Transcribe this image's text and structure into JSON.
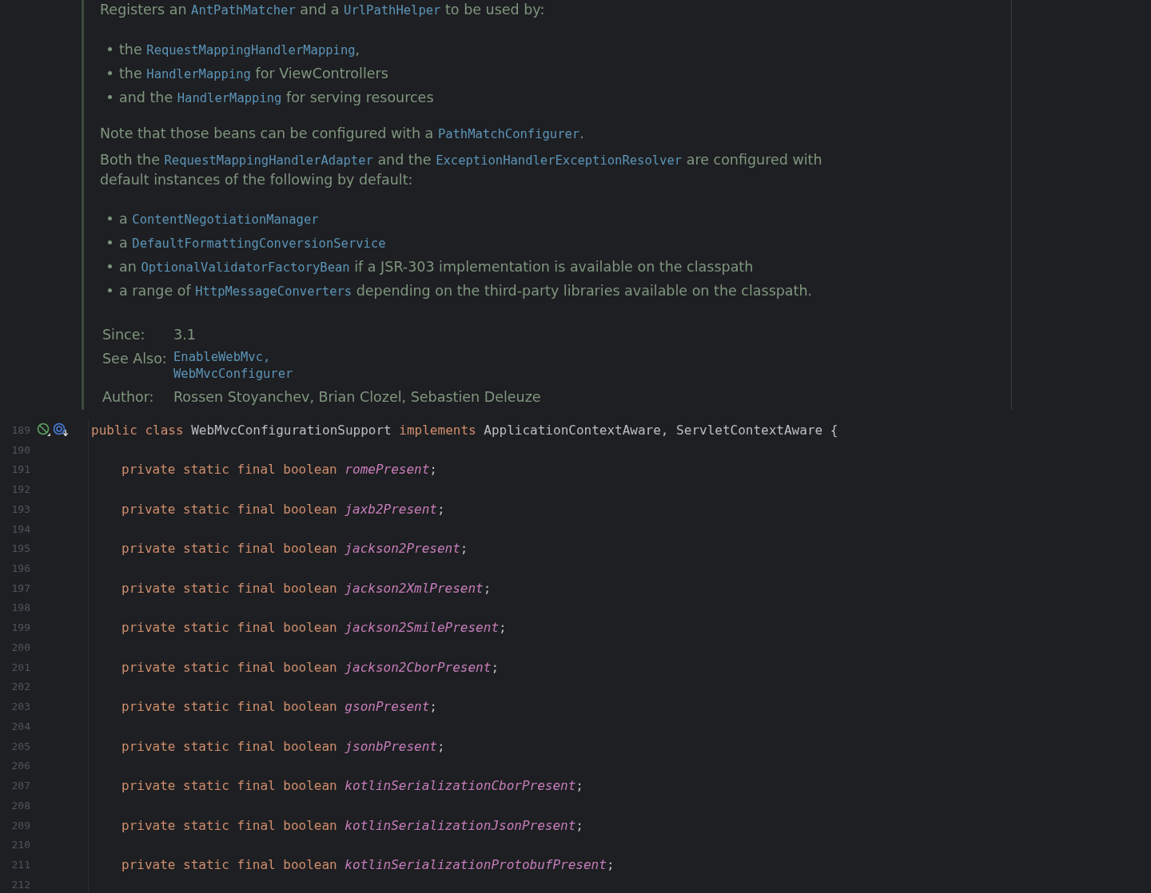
{
  "doc": {
    "paragraphs": [
      {
        "kind": "para",
        "parts": [
          {
            "kind": "text",
            "text": "Registers an "
          },
          {
            "kind": "code",
            "text": "AntPathMatcher"
          },
          {
            "kind": "text",
            "text": " and a "
          },
          {
            "kind": "code",
            "text": "UrlPathHelper"
          },
          {
            "kind": "text",
            "text": " to be used by:"
          }
        ]
      },
      {
        "kind": "bullet",
        "parts": [
          {
            "kind": "text",
            "text": "the "
          },
          {
            "kind": "code",
            "text": "RequestMappingHandlerMapping"
          },
          {
            "kind": "text",
            "text": ","
          }
        ]
      },
      {
        "kind": "bullet",
        "parts": [
          {
            "kind": "text",
            "text": "the "
          },
          {
            "kind": "code",
            "text": "HandlerMapping"
          },
          {
            "kind": "text",
            "text": " for ViewControllers"
          }
        ]
      },
      {
        "kind": "bullet",
        "parts": [
          {
            "kind": "text",
            "text": "and the "
          },
          {
            "kind": "code",
            "text": "HandlerMapping"
          },
          {
            "kind": "text",
            "text": " for serving resources"
          }
        ]
      },
      {
        "kind": "para",
        "parts": [
          {
            "kind": "text",
            "text": "Note that those beans can be configured with a "
          },
          {
            "kind": "code",
            "text": "PathMatchConfigurer"
          },
          {
            "kind": "text",
            "text": "."
          }
        ]
      },
      {
        "kind": "para",
        "parts": [
          {
            "kind": "text",
            "text": "Both the "
          },
          {
            "kind": "code",
            "text": "RequestMappingHandlerAdapter"
          },
          {
            "kind": "text",
            "text": " and the "
          },
          {
            "kind": "code",
            "text": "ExceptionHandlerExceptionResolver"
          },
          {
            "kind": "text",
            "text": " are configured with default instances of the following by default:"
          }
        ]
      },
      {
        "kind": "bullet",
        "parts": [
          {
            "kind": "text",
            "text": "a "
          },
          {
            "kind": "code",
            "text": "ContentNegotiationManager"
          }
        ]
      },
      {
        "kind": "bullet",
        "parts": [
          {
            "kind": "text",
            "text": "a "
          },
          {
            "kind": "code",
            "text": "DefaultFormattingConversionService"
          }
        ]
      },
      {
        "kind": "bullet",
        "parts": [
          {
            "kind": "text",
            "text": "an "
          },
          {
            "kind": "code",
            "text": "OptionalValidatorFactoryBean"
          },
          {
            "kind": "text",
            "text": " if a JSR-303 implementation is available on the classpath"
          }
        ]
      },
      {
        "kind": "bullet",
        "parts": [
          {
            "kind": "text",
            "text": "a range of "
          },
          {
            "kind": "code",
            "text": "HttpMessageConverters"
          },
          {
            "kind": "text",
            "text": " depending on the third-party libraries available on the classpath."
          }
        ]
      }
    ],
    "tags": [
      {
        "label": "Since:",
        "values": [
          "3.1"
        ],
        "kind": "text"
      },
      {
        "label": "See Also:",
        "values": [
          "EnableWebMvc,",
          "WebMvcConfigurer"
        ],
        "kind": "code"
      },
      {
        "label": "Author:",
        "values": [
          "Rossen Stoyanchev, Brian Clozel, Sebastien Deleuze"
        ],
        "kind": "text"
      }
    ]
  },
  "code_lines": [
    {
      "number": "189",
      "kind": "declaration",
      "tokens": [
        {
          "kind": "keyword",
          "text": "public class "
        },
        {
          "kind": "plain",
          "text": "WebMvcConfigurationSupport "
        },
        {
          "kind": "keyword",
          "text": "implements "
        },
        {
          "kind": "plain",
          "text": "ApplicationContextAware, ServletContextAware {"
        }
      ]
    },
    {
      "number": "190",
      "kind": "blank"
    },
    {
      "number": "191",
      "kind": "member",
      "tokens": [
        {
          "kind": "keyword",
          "text": "private static final boolean "
        },
        {
          "kind": "field",
          "text": "romePresent"
        },
        {
          "kind": "plain",
          "text": ";"
        }
      ]
    },
    {
      "number": "192",
      "kind": "blank"
    },
    {
      "number": "193",
      "kind": "member",
      "tokens": [
        {
          "kind": "keyword",
          "text": "private static final boolean "
        },
        {
          "kind": "field",
          "text": "jaxb2Present"
        },
        {
          "kind": "plain",
          "text": ";"
        }
      ]
    },
    {
      "number": "194",
      "kind": "blank"
    },
    {
      "number": "195",
      "kind": "member",
      "tokens": [
        {
          "kind": "keyword",
          "text": "private static final boolean "
        },
        {
          "kind": "field",
          "text": "jackson2Present"
        },
        {
          "kind": "plain",
          "text": ";"
        }
      ]
    },
    {
      "number": "196",
      "kind": "blank"
    },
    {
      "number": "197",
      "kind": "member",
      "tokens": [
        {
          "kind": "keyword",
          "text": "private static final boolean "
        },
        {
          "kind": "field",
          "text": "jackson2XmlPresent"
        },
        {
          "kind": "plain",
          "text": ";"
        }
      ]
    },
    {
      "number": "198",
      "kind": "blank"
    },
    {
      "number": "199",
      "kind": "member",
      "tokens": [
        {
          "kind": "keyword",
          "text": "private static final boolean "
        },
        {
          "kind": "field",
          "text": "jackson2SmilePresent"
        },
        {
          "kind": "plain",
          "text": ";"
        }
      ]
    },
    {
      "number": "200",
      "kind": "blank"
    },
    {
      "number": "201",
      "kind": "member",
      "tokens": [
        {
          "kind": "keyword",
          "text": "private static final boolean "
        },
        {
          "kind": "field",
          "text": "jackson2CborPresent"
        },
        {
          "kind": "plain",
          "text": ";"
        }
      ]
    },
    {
      "number": "202",
      "kind": "blank"
    },
    {
      "number": "203",
      "kind": "member",
      "tokens": [
        {
          "kind": "keyword",
          "text": "private static final boolean "
        },
        {
          "kind": "field",
          "text": "gsonPresent"
        },
        {
          "kind": "plain",
          "text": ";"
        }
      ]
    },
    {
      "number": "204",
      "kind": "blank"
    },
    {
      "number": "205",
      "kind": "member",
      "tokens": [
        {
          "kind": "keyword",
          "text": "private static final boolean "
        },
        {
          "kind": "field",
          "text": "jsonbPresent"
        },
        {
          "kind": "plain",
          "text": ";"
        }
      ]
    },
    {
      "number": "206",
      "kind": "blank"
    },
    {
      "number": "207",
      "kind": "member",
      "tokens": [
        {
          "kind": "keyword",
          "text": "private static final boolean "
        },
        {
          "kind": "field",
          "text": "kotlinSerializationCborPresent"
        },
        {
          "kind": "plain",
          "text": ";"
        }
      ]
    },
    {
      "number": "208",
      "kind": "blank"
    },
    {
      "number": "209",
      "kind": "member",
      "tokens": [
        {
          "kind": "keyword",
          "text": "private static final boolean "
        },
        {
          "kind": "field",
          "text": "kotlinSerializationJsonPresent"
        },
        {
          "kind": "plain",
          "text": ";"
        }
      ]
    },
    {
      "number": "210",
      "kind": "blank"
    },
    {
      "number": "211",
      "kind": "member",
      "tokens": [
        {
          "kind": "keyword",
          "text": "private static final boolean "
        },
        {
          "kind": "field",
          "text": "kotlinSerializationProtobufPresent"
        },
        {
          "kind": "plain",
          "text": ";"
        }
      ]
    },
    {
      "number": "212",
      "kind": "blank"
    }
  ]
}
